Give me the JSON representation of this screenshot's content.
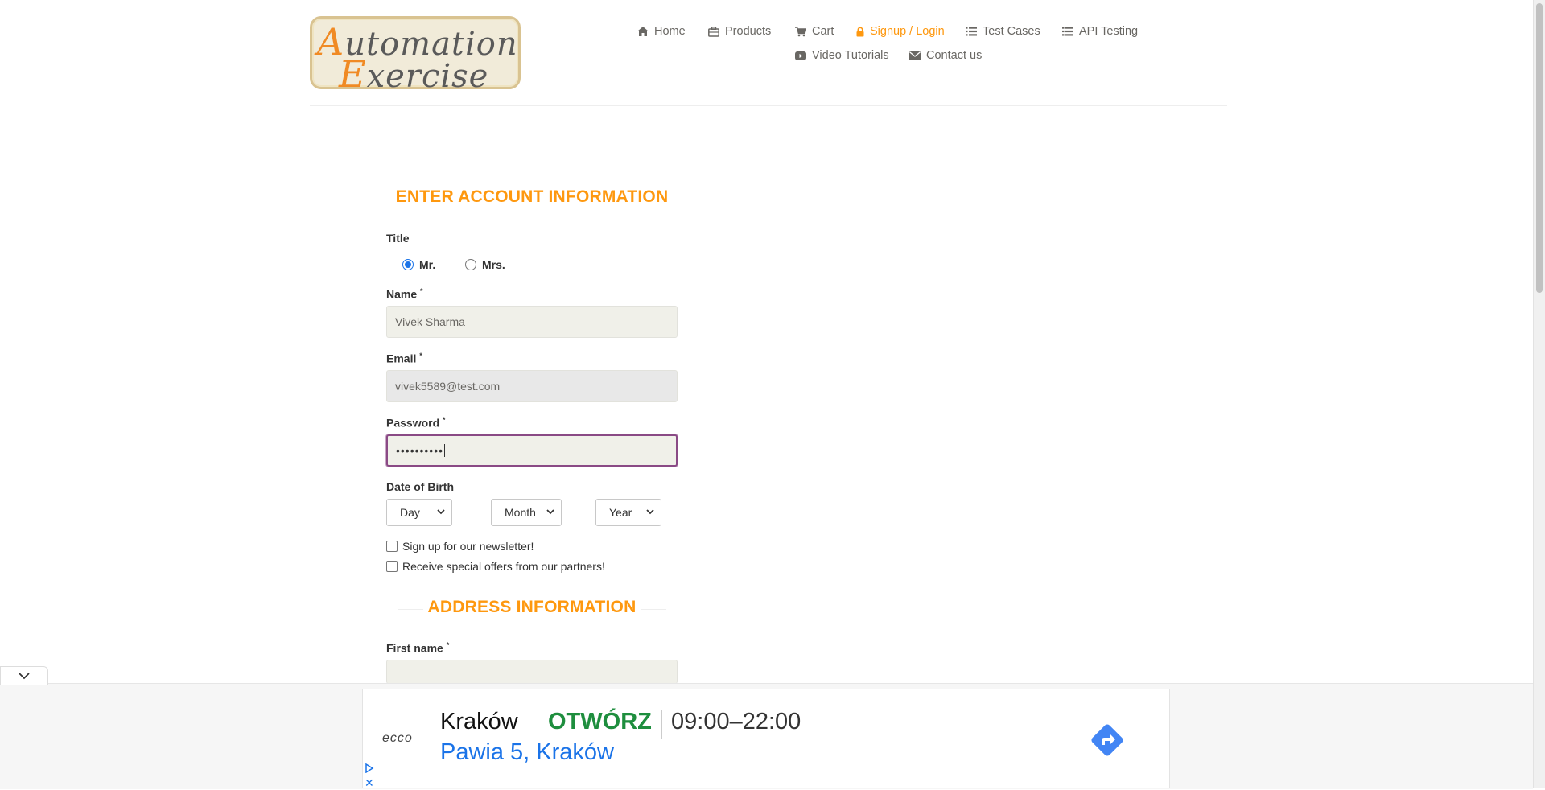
{
  "logo": {
    "line1_initial": "A",
    "line1_rest": "utomation",
    "line2_initial": "E",
    "line2_rest": "xercise"
  },
  "nav": [
    {
      "label": "Home",
      "icon": "home-icon",
      "active": false
    },
    {
      "label": "Products",
      "icon": "products-icon",
      "active": false
    },
    {
      "label": "Cart",
      "icon": "cart-icon",
      "active": false
    },
    {
      "label": "Signup / Login",
      "icon": "lock-icon",
      "active": true
    },
    {
      "label": "Test Cases",
      "icon": "list-icon",
      "active": false
    },
    {
      "label": "API Testing",
      "icon": "list-icon",
      "active": false
    },
    {
      "label": "Video Tutorials",
      "icon": "youtube-icon",
      "active": false
    },
    {
      "label": "Contact us",
      "icon": "envelope-icon",
      "active": false
    }
  ],
  "form": {
    "account_title": "ENTER ACCOUNT INFORMATION",
    "title_label": "Title",
    "title_options": [
      "Mr.",
      "Mrs."
    ],
    "title_selected": "Mr.",
    "name_label": "Name",
    "name_value": "Vivek Sharma",
    "email_label": "Email",
    "email_value": "vivek5589@test.com",
    "password_label": "Password",
    "password_value": "••••••••••",
    "required_mark": "*",
    "dob_label": "Date of Birth",
    "day_value": "Day",
    "month_value": "Month",
    "year_value": "Year",
    "newsletter_label": "Sign up for our newsletter!",
    "offers_label": "Receive special offers from our partners!",
    "address_title": "ADDRESS INFORMATION",
    "first_name_label": "First name"
  },
  "ad": {
    "brand": "ecco",
    "city": "Kraków",
    "status": "OTWÓRZ",
    "hours": "09:00–22:00",
    "address": "Pawia 5, Kraków",
    "close_glyph": "✕"
  },
  "colors": {
    "accent": "#fe980f",
    "nav_text": "#696763",
    "ad_open": "#1e8e3e",
    "ad_link": "#1a73e8"
  }
}
